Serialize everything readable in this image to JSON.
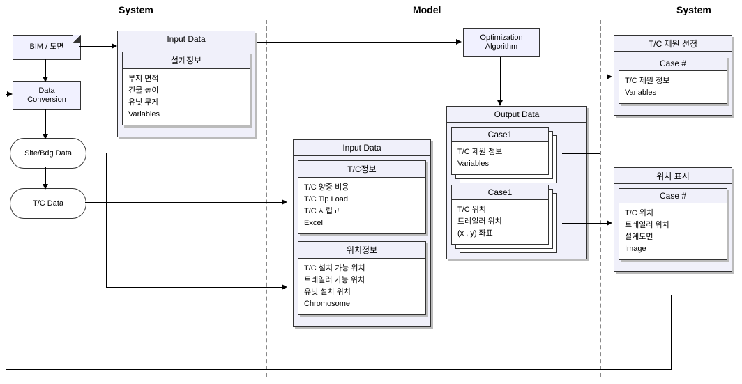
{
  "columns": {
    "left": "System",
    "mid": "Model",
    "right": "System"
  },
  "left": {
    "bim": "BIM / 도면",
    "conv": "Data\nConversion",
    "db1": "Site/Bdg Data",
    "db2": "T/C Data"
  },
  "inputData1": {
    "title": "Input Data",
    "card": {
      "title": "설계정보",
      "lines": [
        "부지 면적",
        "건물 높이",
        "유닛 무게",
        "Variables"
      ]
    }
  },
  "optAlg": "Optimization\nAlgorithm",
  "inputData2": {
    "title": "Input Data",
    "cardA": {
      "title": "T/C정보",
      "lines": [
        "T/C 양중 비용",
        "T/C Tip Load",
        "T/C 자립고",
        "Excel"
      ]
    },
    "cardB": {
      "title": "위치정보",
      "lines": [
        "T/C 설치 가능 위치",
        "트레일러 가능 위치",
        "유닛 설치 위치",
        "Chromosome"
      ]
    }
  },
  "outputData": {
    "title": "Output Data",
    "cardA": {
      "title": "Case1",
      "lines": [
        "T/C 제원 정보",
        "Variables"
      ]
    },
    "cardB": {
      "title": "Case1",
      "lines": [
        "T/C 위치",
        "트레일러 위치",
        "(x , y) 좌표"
      ]
    }
  },
  "right1": {
    "title": "T/C 제원 선정",
    "card": {
      "title": "Case #",
      "lines": [
        "T/C 제원 정보",
        "Variables"
      ]
    }
  },
  "right2": {
    "title": "위치 표시",
    "card": {
      "title": "Case #",
      "lines": [
        "T/C 위치",
        "트레일러 위치",
        "설계도면",
        "Image"
      ]
    }
  }
}
